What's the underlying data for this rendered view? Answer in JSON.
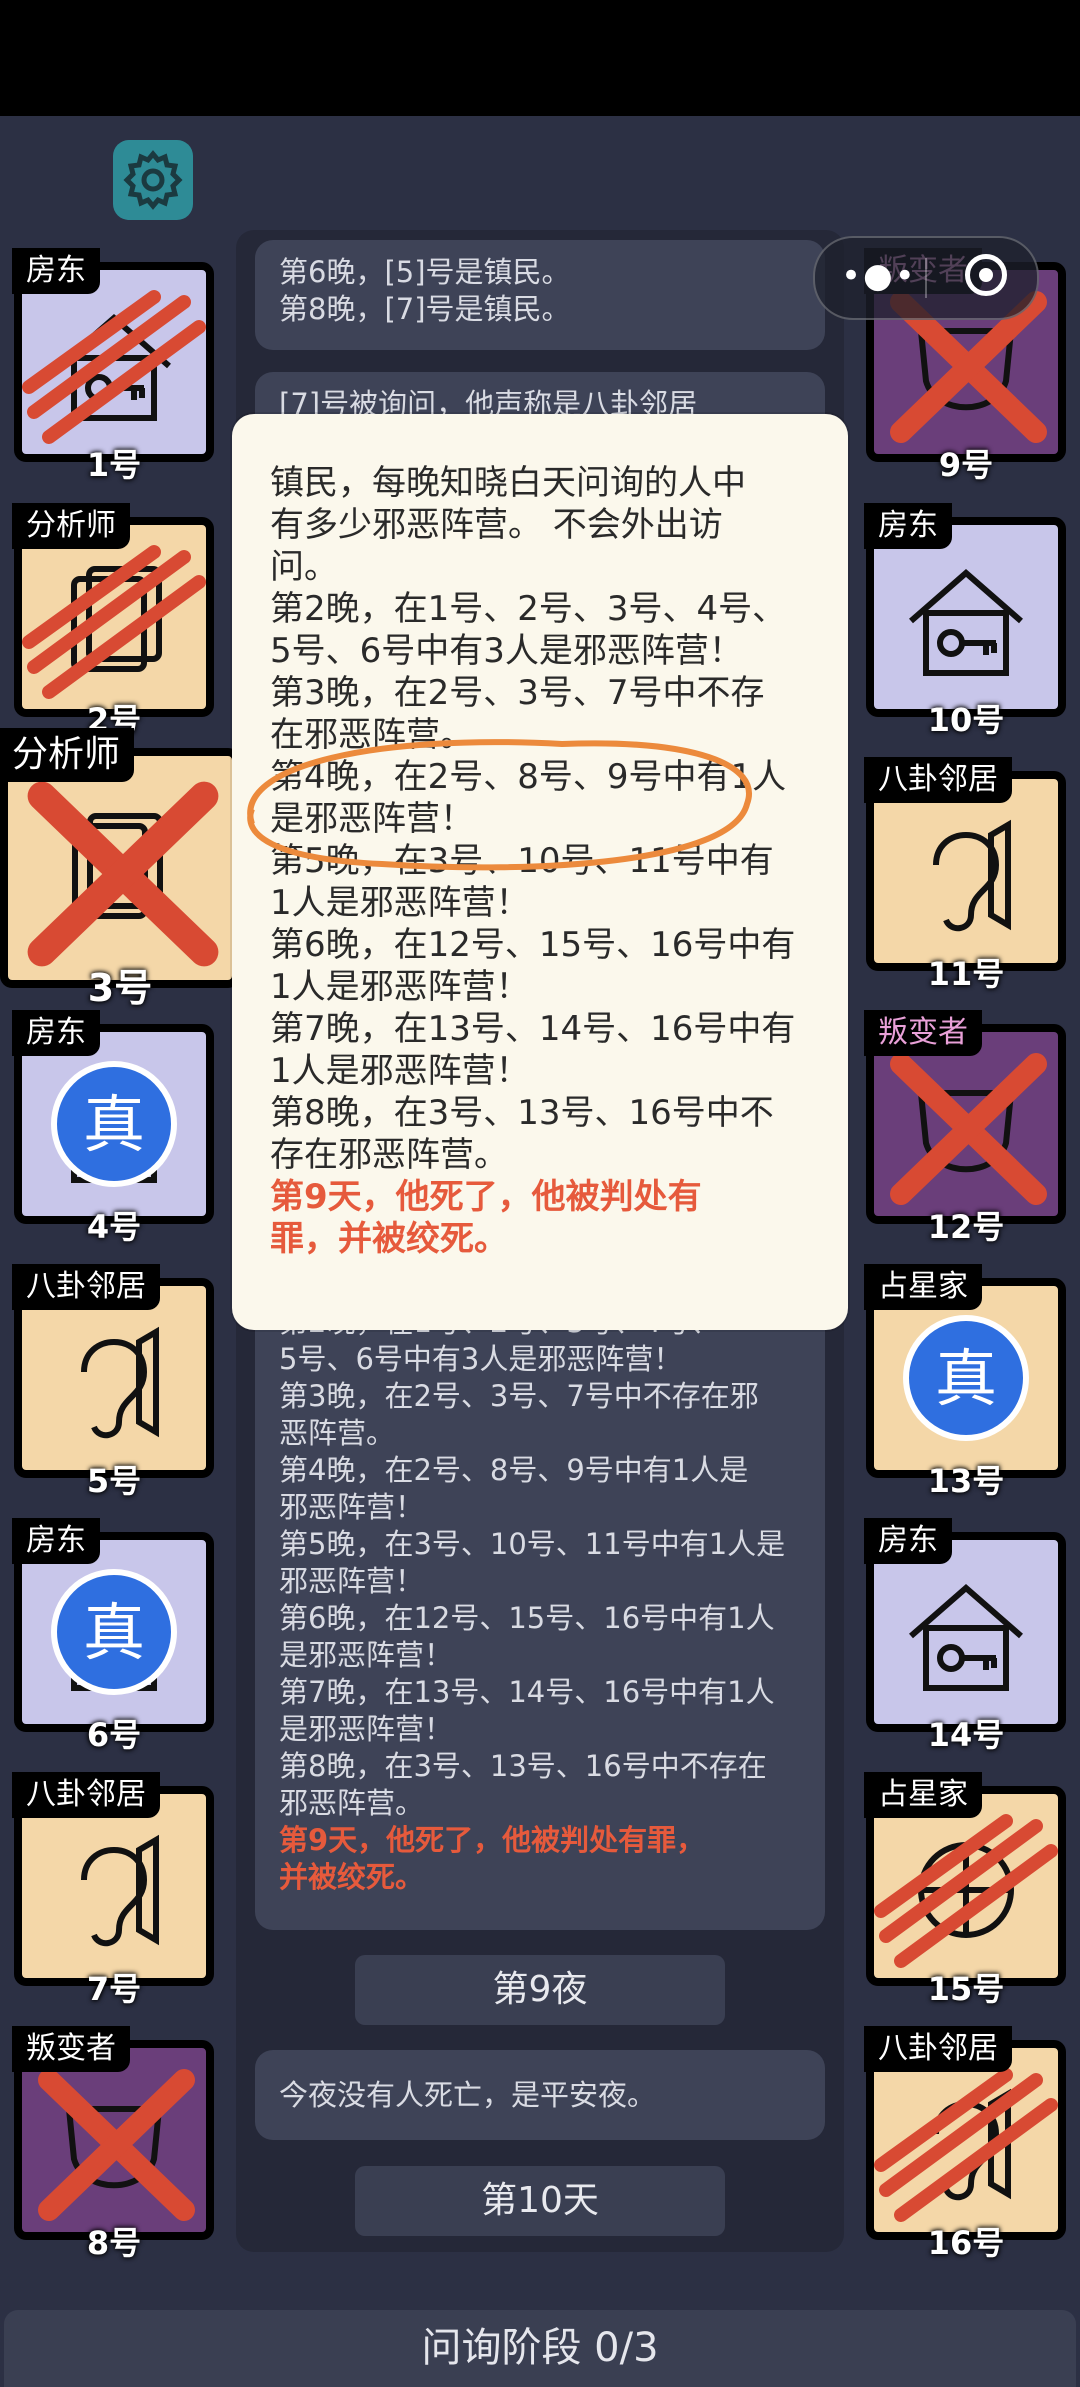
{
  "header": {
    "settings_icon": "gear-icon"
  },
  "mini_program_capsule": {
    "more_icon": "three-dots-icon",
    "close_icon": "target-circle-icon"
  },
  "left_cards": [
    {
      "role": "房东",
      "number": "1号",
      "icon": "house-key-icon",
      "state": "scratched"
    },
    {
      "role": "分析师",
      "number": "2号",
      "icon": "document-icon",
      "state": "scratched"
    },
    {
      "role": "分析师",
      "number": "3号",
      "icon": "document-icon",
      "state": "dead-x",
      "selected": true
    },
    {
      "role": "房东",
      "number": "4号",
      "icon": "house-key-icon",
      "state": "verified"
    },
    {
      "role": "八卦邻居",
      "number": "5号",
      "icon": "ear-icon",
      "state": "normal"
    },
    {
      "role": "房东",
      "number": "6号",
      "icon": "house-key-icon",
      "state": "verified"
    },
    {
      "role": "八卦邻居",
      "number": "7号",
      "icon": "ear-icon",
      "state": "normal"
    },
    {
      "role": "叛变者",
      "number": "8号",
      "icon": "mask-icon",
      "state": "dead-x"
    }
  ],
  "right_cards": [
    {
      "role": "叛变者",
      "number": "9号",
      "icon": "mask-icon",
      "state": "dead-x"
    },
    {
      "role": "房东",
      "number": "10号",
      "icon": "house-key-icon",
      "state": "normal"
    },
    {
      "role": "八卦邻居",
      "number": "11号",
      "icon": "ear-icon",
      "state": "normal"
    },
    {
      "role": "叛变者",
      "number": "12号",
      "icon": "mask-icon",
      "state": "dead-x"
    },
    {
      "role": "占星家",
      "number": "13号",
      "icon": "astrolabe-icon",
      "state": "verified"
    },
    {
      "role": "房东",
      "number": "14号",
      "icon": "house-key-icon",
      "state": "normal"
    },
    {
      "role": "占星家",
      "number": "15号",
      "icon": "astrolabe-icon",
      "state": "scratched"
    },
    {
      "role": "八卦邻居",
      "number": "16号",
      "icon": "ear-icon",
      "state": "scratched"
    }
  ],
  "verified_badge_text": "真",
  "log": {
    "top_bubble": [
      "第6晚，[5]号是镇民。",
      "第8晚，[7]号是镇民。"
    ],
    "second_bubble_partial": "[7]号被询问，他声称是八卦邻居",
    "third_bubble": [
      "第2晚，在1号、2号、3号、4号、",
      "5号、6号中有3人是邪恶阵营！",
      "第3晚，在2号、3号、7号中不存在邪",
      "恶阵营。",
      "第4晚，在2号、8号、9号中有1人是",
      "邪恶阵营！",
      "第5晚，在3号、10号、11号中有1人是",
      "邪恶阵营！",
      "第6晚，在12号、15号、16号中有1人",
      "是邪恶阵营！",
      "第7晚，在13号、14号、16号中有1人",
      "是邪恶阵营！",
      "第8晚，在3号、13号、16号中不存在",
      "邪恶阵营。"
    ],
    "third_bubble_red": [
      "第9天，他死了，他被判处有罪，",
      "并被绞死。"
    ],
    "night_label": "第9夜",
    "night_message": "今夜没有人死亡，是平安夜。",
    "day_label": "第10天"
  },
  "popup": {
    "lines": [
      "镇民，每晚知晓白天问询的人中",
      "有多少邪恶阵营。 不会外出访",
      "问。",
      "第2晚，在1号、2号、3号、4号、",
      "5号、6号中有3人是邪恶阵营！",
      "第3晚，在2号、3号、7号中不存",
      "在邪恶阵营。",
      "第4晚，在2号、8号、9号中有1人",
      "是邪恶阵营！",
      "第5晚，在3号、10号、11号中有",
      "1人是邪恶阵营！",
      "第6晚，在12号、15号、16号中有",
      "1人是邪恶阵营！",
      "第7晚，在13号、14号、16号中有",
      "1人是邪恶阵营！",
      "第8晚，在3号、13号、16号中不",
      "存在邪恶阵营。"
    ],
    "red_lines": [
      "第9天，他死了，他被判处有",
      "罪，并被绞死。"
    ]
  },
  "footer": {
    "phase_text": "问询阶段 0/3"
  },
  "colors": {
    "background": "#2c3044",
    "accent_red": "#e65a3c",
    "verified_blue": "#2f6fe0",
    "popup_bg": "#fbf8ec",
    "circle_orange": "#ec8a3c"
  }
}
